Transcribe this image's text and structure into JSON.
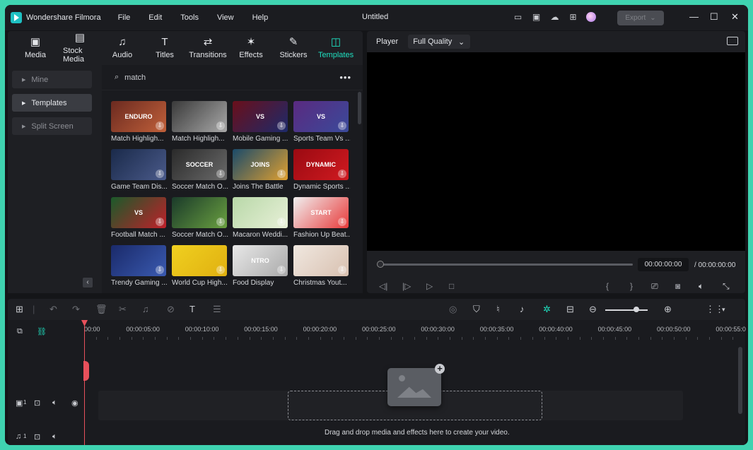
{
  "app": {
    "name": "Wondershare Filmora",
    "document_title": "Untitled",
    "menu": [
      "File",
      "Edit",
      "Tools",
      "View",
      "Help"
    ],
    "export_label": "Export"
  },
  "toolbar_tabs": [
    {
      "label": "Media",
      "icon": "media-icon",
      "glyph": "▣"
    },
    {
      "label": "Stock Media",
      "icon": "stock-media-icon",
      "glyph": "▤"
    },
    {
      "label": "Audio",
      "icon": "music-note-icon",
      "glyph": "♫"
    },
    {
      "label": "Titles",
      "icon": "text-t-icon",
      "glyph": "T"
    },
    {
      "label": "Transitions",
      "icon": "transition-icon",
      "glyph": "⇄"
    },
    {
      "label": "Effects",
      "icon": "sparkle-icon",
      "glyph": "✶"
    },
    {
      "label": "Stickers",
      "icon": "sticker-icon",
      "glyph": "✎"
    },
    {
      "label": "Templates",
      "icon": "template-icon",
      "glyph": "◫"
    }
  ],
  "active_tab": "Templates",
  "sidebar": {
    "items": [
      {
        "label": "Mine"
      },
      {
        "label": "Templates"
      },
      {
        "label": "Split Screen"
      }
    ],
    "active": "Templates"
  },
  "search": {
    "value": "match"
  },
  "templates": [
    {
      "label": "Match Highligh...",
      "thumb_text": "ENDURO",
      "colors": [
        "#6b2a20",
        "#c0603a"
      ]
    },
    {
      "label": "Match Highligh...",
      "thumb_text": "",
      "colors": [
        "#3a3a3a",
        "#a8a8a8"
      ]
    },
    {
      "label": "Mobile Gaming ...",
      "thumb_text": "VS",
      "colors": [
        "#6a0f1a",
        "#1d2a6a"
      ]
    },
    {
      "label": "Sports Team Vs ...",
      "thumb_text": "VS",
      "colors": [
        "#5a2a80",
        "#3a4a9a"
      ]
    },
    {
      "label": "Game Team Dis...",
      "thumb_text": "",
      "colors": [
        "#1a2a4a",
        "#4a5a8a"
      ]
    },
    {
      "label": "Soccer Match O...",
      "thumb_text": "SOCCER",
      "colors": [
        "#2a2a2a",
        "#6a6a6a"
      ]
    },
    {
      "label": "Joins The Battle",
      "thumb_text": "JOINS",
      "colors": [
        "#1a4a6a",
        "#e0a030"
      ]
    },
    {
      "label": "Dynamic Sports ...",
      "thumb_text": "DYNAMIC",
      "colors": [
        "#9a0a12",
        "#d01a20"
      ]
    },
    {
      "label": "Football Match ...",
      "thumb_text": "VS",
      "colors": [
        "#1a5a2a",
        "#c0202a"
      ]
    },
    {
      "label": "Soccer Match O...",
      "thumb_text": "",
      "colors": [
        "#1a3a2a",
        "#6aa040"
      ]
    },
    {
      "label": "Macaron Weddi...",
      "thumb_text": "",
      "colors": [
        "#b8d8a8",
        "#e8f0d8"
      ]
    },
    {
      "label": "Fashion Up Beat...",
      "thumb_text": "START",
      "colors": [
        "#f0f0f0",
        "#e83a3a"
      ]
    },
    {
      "label": "Trendy Gaming ...",
      "thumb_text": "",
      "colors": [
        "#1a2a6a",
        "#3a5ab0"
      ]
    },
    {
      "label": "World Cup High...",
      "thumb_text": "",
      "colors": [
        "#f0d020",
        "#e0b010"
      ]
    },
    {
      "label": "Food Display",
      "thumb_text": "NTRO",
      "colors": [
        "#e8e8e8",
        "#aaaaaa"
      ]
    },
    {
      "label": "Christmas Yout...",
      "thumb_text": "",
      "colors": [
        "#f0e8e0",
        "#d8c0b0"
      ]
    }
  ],
  "player": {
    "label": "Player",
    "quality": "Full Quality",
    "current_time": "00:00:00:00",
    "total_time": "/ 00:00:00:00",
    "progress": 0
  },
  "timeline": {
    "ruler": [
      "00:00",
      "00:00:05:00",
      "00:00:10:00",
      "00:00:15:00",
      "00:00:20:00",
      "00:00:25:00",
      "00:00:30:00",
      "00:00:35:00",
      "00:00:40:00",
      "00:00:45:00",
      "00:00:50:00",
      "00:00:55:0"
    ],
    "drop_hint": "Drag and drop media and effects here to create your video.",
    "zoom_level": 0.7,
    "video_track_number": "1",
    "audio_track_number": "1"
  }
}
